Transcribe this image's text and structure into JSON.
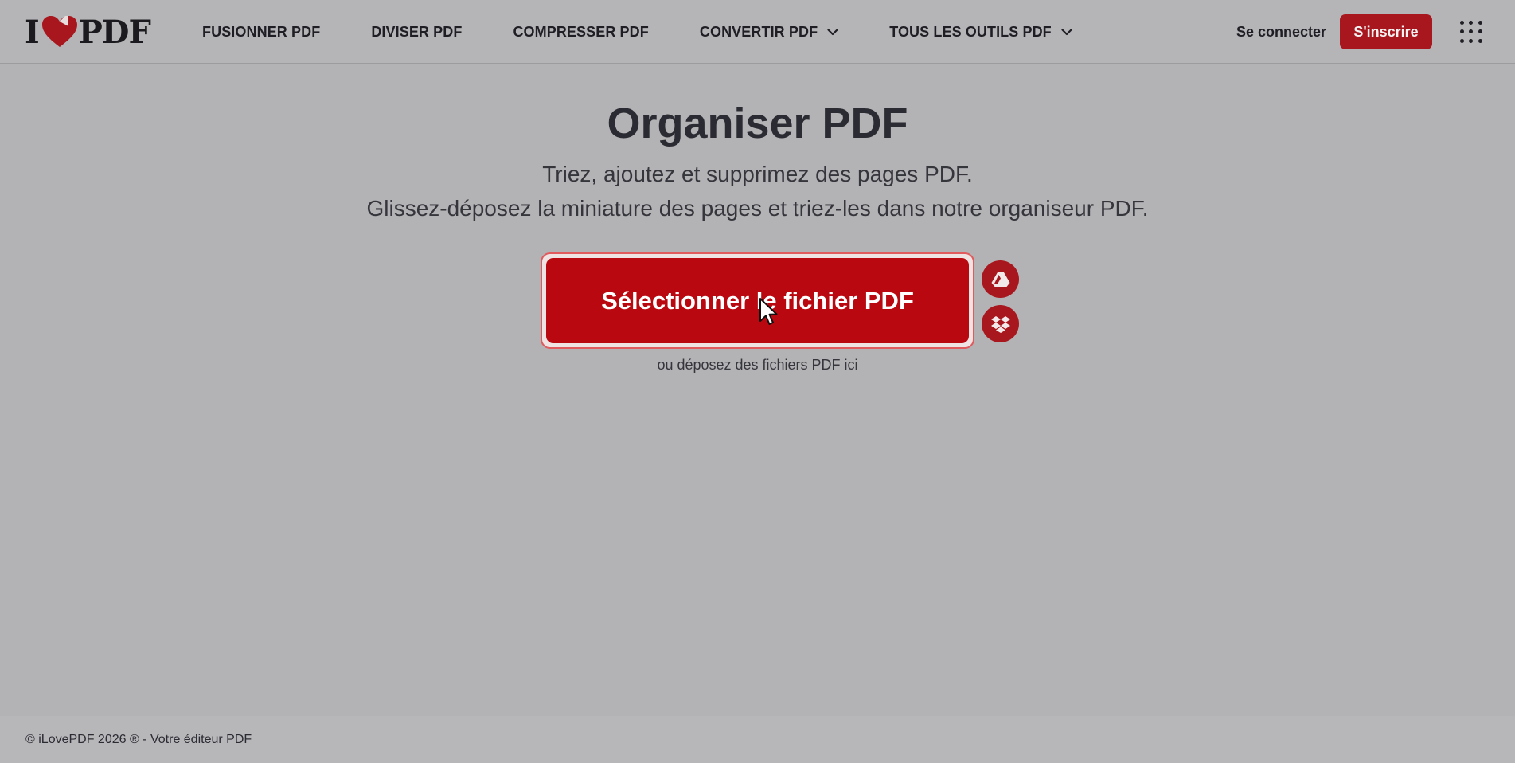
{
  "header": {
    "logo": {
      "left": "I",
      "right": "PDF"
    },
    "nav": [
      {
        "label": "FUSIONNER PDF",
        "has_dropdown": false
      },
      {
        "label": "DIVISER PDF",
        "has_dropdown": false
      },
      {
        "label": "COMPRESSER PDF",
        "has_dropdown": false
      },
      {
        "label": "CONVERTIR PDF",
        "has_dropdown": true
      },
      {
        "label": "TOUS LES OUTILS PDF",
        "has_dropdown": true
      }
    ],
    "login_label": "Se connecter",
    "signup_label": "S'inscrire",
    "apps_icon": "grid-apps-icon"
  },
  "main": {
    "title": "Organiser PDF",
    "subtitle_line1": "Triez, ajoutez et supprimez des pages PDF.",
    "subtitle_line2": "Glissez-déposez la miniature des pages et triez-les dans notre organiseur PDF.",
    "upload_button_label": "Sélectionner le fichier PDF",
    "cloud_buttons": [
      {
        "icon": "google-drive-icon"
      },
      {
        "icon": "dropbox-icon"
      }
    ],
    "drop_hint": "ou déposez des fichiers PDF ici"
  },
  "footer": {
    "text": "© iLovePDF 2026 ® - Votre éditeur PDF"
  },
  "colors": {
    "brand_red": "#b90810",
    "signup_red": "#a9171e",
    "overlay_background": "#b3b3b5",
    "text_dark": "#2b2b33"
  }
}
